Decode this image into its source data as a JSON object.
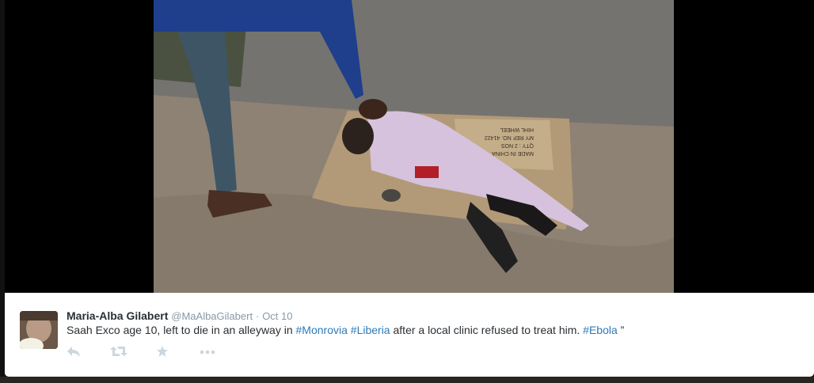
{
  "tweet": {
    "fullname": "Maria-Alba Gilabert",
    "username": "@MaAlbaGilabert",
    "separator": "·",
    "time": "Oct 10",
    "text_parts": {
      "p1": "Saah Exco age 10, left to die in an alleyway in ",
      "tag1": "#Monrovia",
      "space1": " ",
      "tag2": "#Liberia",
      "p2": " after a local clinic refused to treat him. ",
      "tag3": "#Ebola",
      "p3": " ”"
    }
  },
  "media": {
    "cardboard_text": [
      "MADE IN CHINA",
      "QTY : 2 NOS",
      "MY REF NO. 41422",
      "HIHL WHEEL"
    ]
  },
  "icons": {
    "reply": "reply-icon",
    "retweet": "retweet-icon",
    "favorite": "star-icon",
    "more": "more-icon"
  }
}
